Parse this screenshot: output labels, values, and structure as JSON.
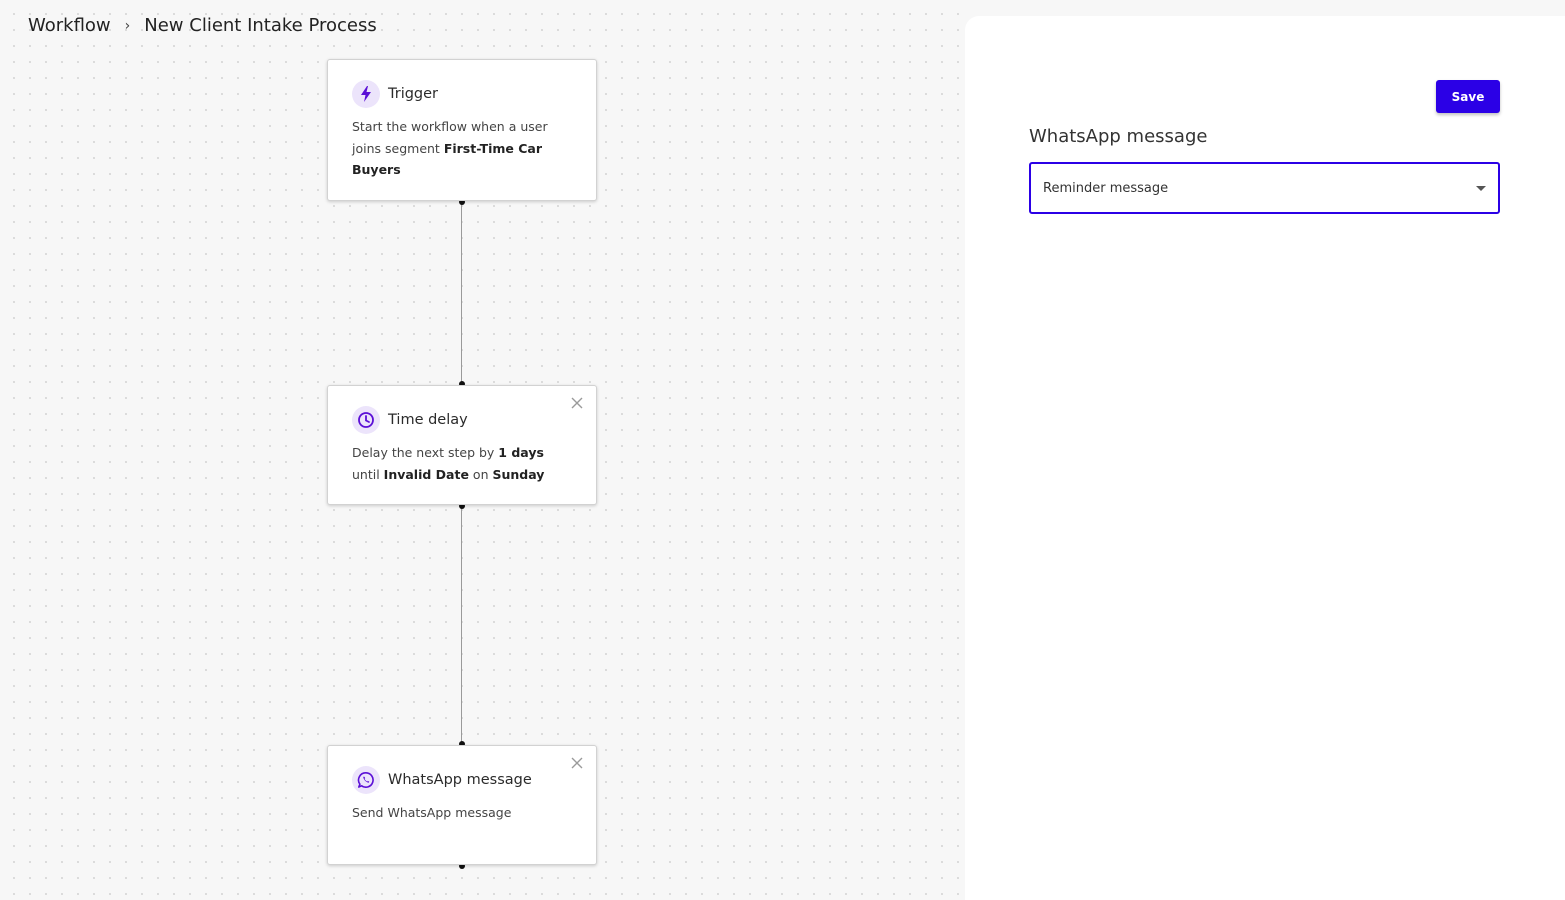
{
  "breadcrumb": {
    "root": "Workflow",
    "separator": "›",
    "current": "New Client Intake Process"
  },
  "nodes": [
    {
      "title": "Trigger",
      "icon": "lightning-icon",
      "text_1": "Start the workflow when a user joins segment ",
      "bold_1": "First-Time Car Buyers"
    },
    {
      "title": "Time delay",
      "icon": "clock-icon",
      "text_1": "Delay the next step by ",
      "bold_1": "1 days",
      "text_2": " until ",
      "bold_2": "Invalid Date",
      "text_3": " on ",
      "bold_3": "Sunday"
    },
    {
      "title": "WhatsApp message",
      "icon": "whatsapp-icon",
      "text_1": "Send WhatsApp message"
    }
  ],
  "panel": {
    "save_label": "Save",
    "title": "WhatsApp message",
    "select_value": "Reminder message"
  },
  "colors": {
    "accent": "#2b00e6",
    "icon_color": "#5b0fd6",
    "icon_bg": "#ece4fb"
  }
}
